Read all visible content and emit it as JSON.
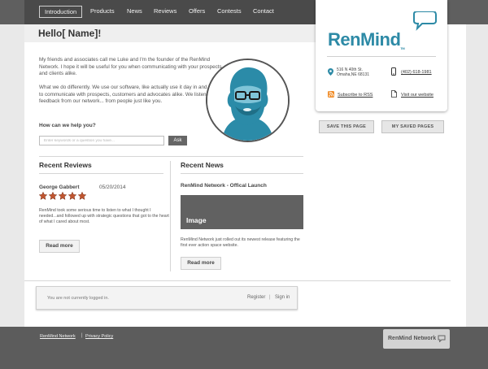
{
  "nav": {
    "items": [
      {
        "label": "Introduction",
        "active": true
      },
      {
        "label": "Products"
      },
      {
        "label": "News"
      },
      {
        "label": "Reviews"
      },
      {
        "label": "Offers"
      },
      {
        "label": "Contests"
      },
      {
        "label": "Contact"
      }
    ]
  },
  "page": {
    "title": "Hello[ Name]!",
    "intro_1": "My friends and associates call me Luke and I'm the founder of the RenMind Network.  I hope it will be useful for you when communicating with your prospects and clients alike.",
    "intro_2": "What we do differently.  We use our software, like actually use it day in and day out to communicate with prospects, customers and advocates alike.  We listen to feedback from our network... from people just like you."
  },
  "help": {
    "label": "How can we help you?",
    "placeholder": "Enter keywords or a question you have...",
    "ask_label": "Ask"
  },
  "card": {
    "logo_text": "RenMind",
    "logo_suffix": "TM",
    "address_line1": "516 N 40th St.",
    "address_line2": "Omaha,NE 68131",
    "phone": "(402) 618-1981",
    "rss_label": "Subscribe to RSS",
    "website_label": "Visit our website"
  },
  "actions": {
    "save_page": "SAVE THIS PAGE",
    "saved_pages": "MY SAVED PAGES"
  },
  "reviews": {
    "heading": "Recent Reviews",
    "reviewer": "George Gabbert",
    "date": "05/20/2014",
    "rating": 5,
    "text": "RenMind took some serious time to listen to what I thought I needed...and followed up with strategic questions that got to the heart of what I cared about most.",
    "read_more": "Read more"
  },
  "news": {
    "heading": "Recent News",
    "title": "RenMind Network - Offical Launch",
    "image_label": "Image",
    "text": "RenMind Network just rolled out its newest release featuring the first ever action space website.",
    "read_more": "Read more"
  },
  "login": {
    "status": "You are not currently logged in.",
    "register": "Register",
    "separator": "|",
    "sign_in": "Sign in"
  },
  "footer": {
    "brand_link": "RenMind Network",
    "separator": "|",
    "privacy_link": "Privacy Policy",
    "badge_label": "RenMind Network"
  },
  "colors": {
    "brand": "#2d8aa6",
    "star": "#c0552f",
    "rss": "#f08a24",
    "nav_bg": "#4a4a4a",
    "footer_bg": "#5c5c5c"
  }
}
